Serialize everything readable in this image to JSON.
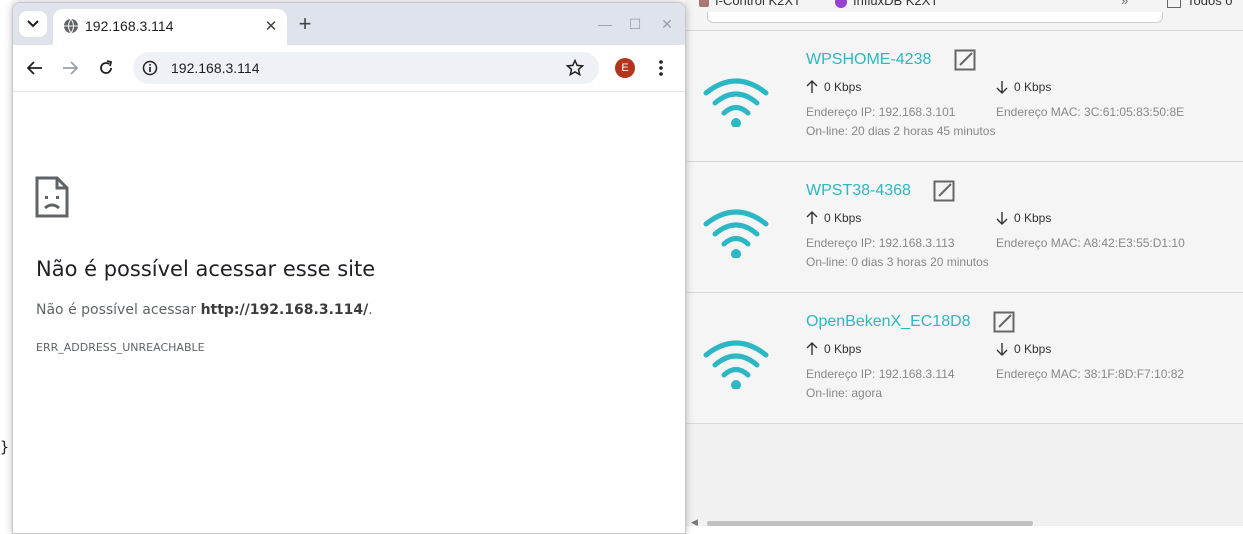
{
  "browser": {
    "tab_title": "192.168.3.114",
    "url": "192.168.3.114",
    "profile_initial": "E"
  },
  "error": {
    "title": "Não é possível acessar esse site",
    "line_prefix": "Não é possível acessar ",
    "line_url": "http://192.168.3.114/",
    "line_suffix": ".",
    "code": "ERR_ADDRESS_UNREACHABLE"
  },
  "bookmarks": {
    "item1": "I-Control K2XT",
    "item2": "InfluxDB K2XT",
    "item3": "Todos o"
  },
  "colors": {
    "accent": "#2bb8c4",
    "profile": "#b5341c"
  },
  "clients": [
    {
      "name": "WPSHOME-4238",
      "up": "0 Kbps",
      "down": "0 Kbps",
      "ip": "Endereço IP: 192.168.3.101",
      "mac": "Endereço MAC: 3C:61:05:83:50:8E",
      "online": "On-line: 20 dias 2 horas 45 minutos"
    },
    {
      "name": "WPST38-4368",
      "up": "0 Kbps",
      "down": "0 Kbps",
      "ip": "Endereço IP: 192.168.3.113",
      "mac": "Endereço MAC: A8:42:E3:55:D1:10",
      "online": "On-line: 0 dias 3 horas 20 minutos"
    },
    {
      "name": "OpenBekenX_EC18D8",
      "up": "0 Kbps",
      "down": "0 Kbps",
      "ip": "Endereço IP: 192.168.3.114",
      "mac": "Endereço MAC: 38:1F:8D:F7:10:82",
      "online": "On-line: agora"
    }
  ],
  "editor": {
    "brace": "}"
  }
}
